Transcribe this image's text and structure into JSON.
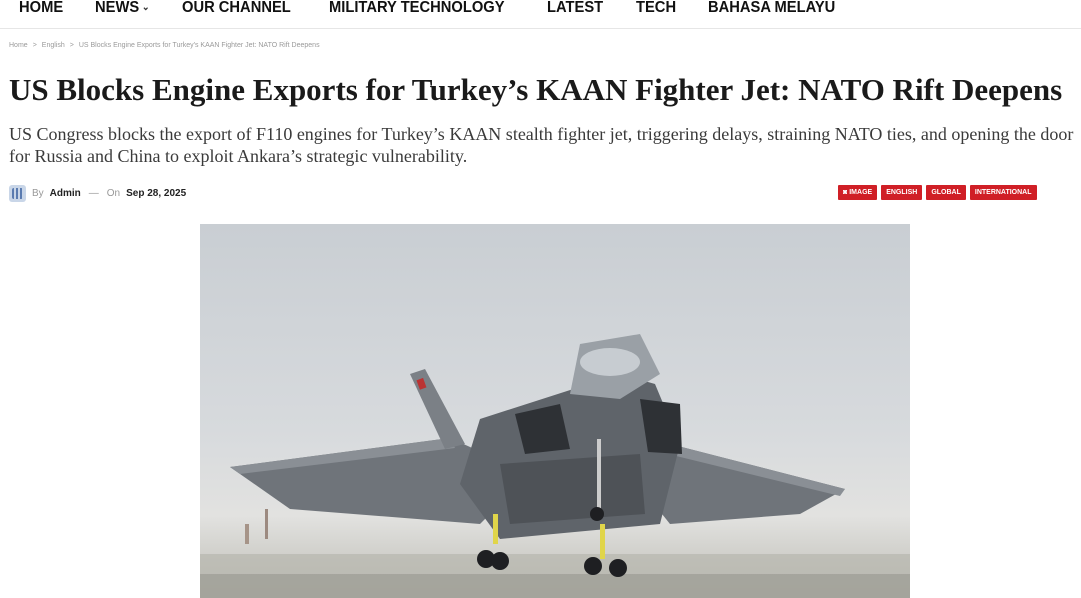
{
  "nav": {
    "items": [
      {
        "label": "HOME",
        "chevron": false
      },
      {
        "label": "NEWS",
        "chevron": true
      },
      {
        "label": "OUR CHANNEL",
        "chevron": false
      },
      {
        "label": "MILITARY TECHNOLOGY",
        "chevron": false
      },
      {
        "label": "LATEST",
        "chevron": false
      },
      {
        "label": "TECH",
        "chevron": false
      },
      {
        "label": "BAHASA MELAYU",
        "chevron": false
      }
    ]
  },
  "breadcrumb": {
    "home": "Home",
    "section": "English",
    "current": "US Blocks Engine Exports for Turkey's KAAN Fighter Jet: NATO Rift Deepens",
    "separator": ">"
  },
  "article": {
    "title": "US Blocks Engine Exports for Turkey’s KAAN Fighter Jet: NATO Rift Deepens",
    "subtitle": "US Congress blocks the export of F110 engines for Turkey’s KAAN stealth fighter jet, triggering delays, straining NATO ties, and opening the door for Russia and China to exploit Ankara’s strategic vulnerability.",
    "by_label": "By",
    "author": "Admin",
    "dash": "—",
    "on_label": "On",
    "date": "Sep 28, 2025"
  },
  "tags": [
    "IMAGE",
    "ENGLISH",
    "GLOBAL",
    "INTERNATIONAL"
  ],
  "colors": {
    "tag_bg": "#d01f26",
    "text_primary": "#1a1a1a",
    "text_muted": "#999999"
  },
  "icons": {
    "nav_chevron": "chevron-down-icon",
    "avatar": "avatar-icon",
    "image_tag": "camera-icon"
  }
}
